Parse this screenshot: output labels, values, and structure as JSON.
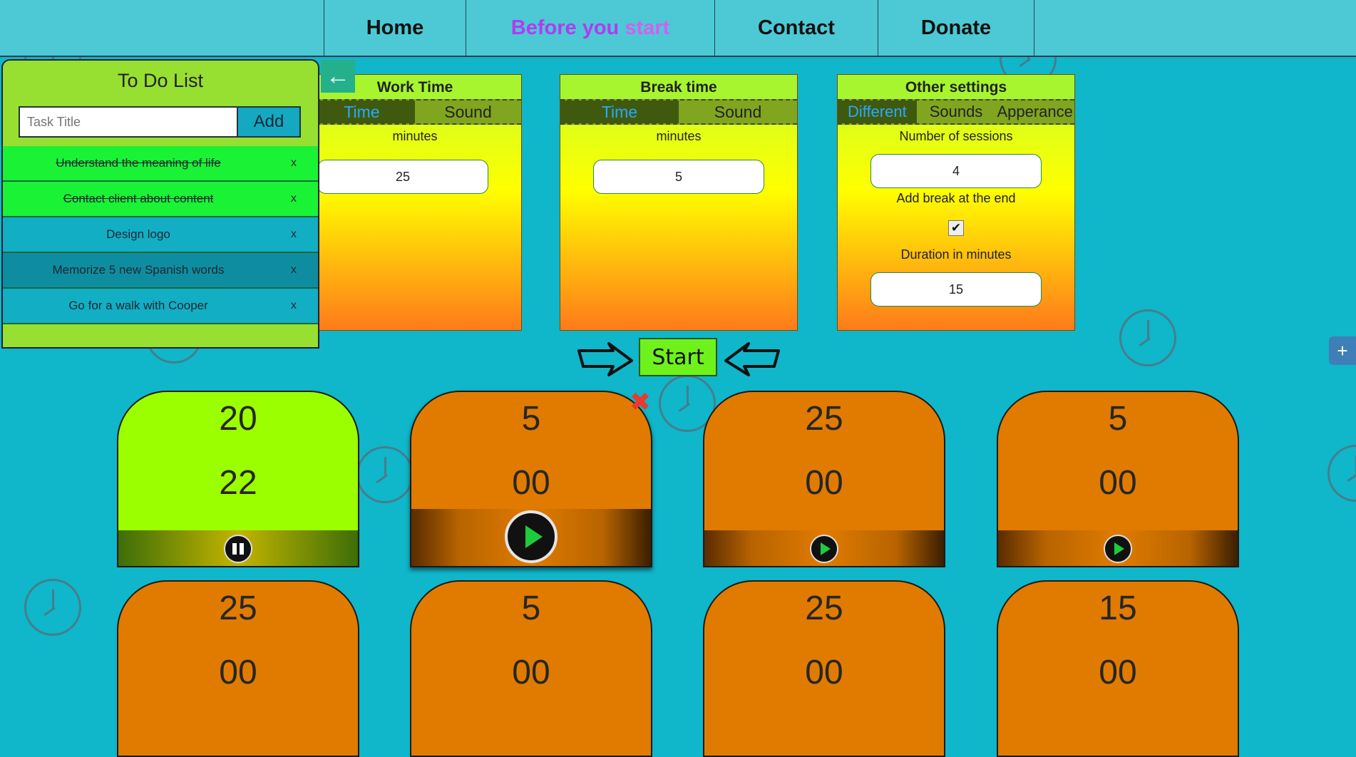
{
  "nav": {
    "items": [
      {
        "label": "Home"
      },
      {
        "label_part1": "Before you ",
        "label_part2": "start"
      },
      {
        "label": "Contact"
      },
      {
        "label": "Donate"
      }
    ]
  },
  "todo": {
    "title": "To Do List",
    "input_placeholder": "Task Title",
    "add_label": "Add",
    "remove_label": "x",
    "items": [
      {
        "text": "Understand the meaning of life",
        "status": "done"
      },
      {
        "text": "Contact client about content",
        "status": "done"
      },
      {
        "text": "Design logo",
        "status": "pending"
      },
      {
        "text": "Memorize 5 new Spanish words",
        "status": "hover"
      },
      {
        "text": "Go for a walk with Cooper",
        "status": "pending"
      }
    ]
  },
  "settings": {
    "work": {
      "title": "Work Time",
      "tabs": [
        "Time",
        "Sound"
      ],
      "label": "minutes",
      "value": "25"
    },
    "break": {
      "title": "Break time",
      "tabs": [
        "Time",
        "Sound"
      ],
      "label": "minutes",
      "value": "5"
    },
    "other": {
      "title": "Other settings",
      "tabs": [
        "Different",
        "Sounds",
        "Apperance"
      ],
      "sessions_label": "Number of sessions",
      "sessions_value": "4",
      "break_end_label": "Add break at the end",
      "break_end_checked": true,
      "check_glyph": "✔",
      "duration_label": "Duration in minutes",
      "duration_value": "15"
    }
  },
  "start_label": "Start",
  "timers": [
    {
      "min": "20",
      "sec": "22",
      "state": "running"
    },
    {
      "min": "5",
      "sec": "00",
      "state": "selected"
    },
    {
      "min": "25",
      "sec": "00",
      "state": "idle"
    },
    {
      "min": "5",
      "sec": "00",
      "state": "idle"
    },
    {
      "min": "25",
      "sec": "00",
      "state": "idle"
    },
    {
      "min": "5",
      "sec": "00",
      "state": "idle"
    },
    {
      "min": "25",
      "sec": "00",
      "state": "idle"
    },
    {
      "min": "15",
      "sec": "00",
      "state": "idle"
    }
  ],
  "delete_glyph": "✖",
  "back_glyph": "←",
  "side_tab_glyph": "+",
  "colors": {
    "background": "#10b6c9",
    "active_nav": "#b23bf0",
    "running_card": "#9cff00",
    "idle_card": "#e07b00"
  }
}
